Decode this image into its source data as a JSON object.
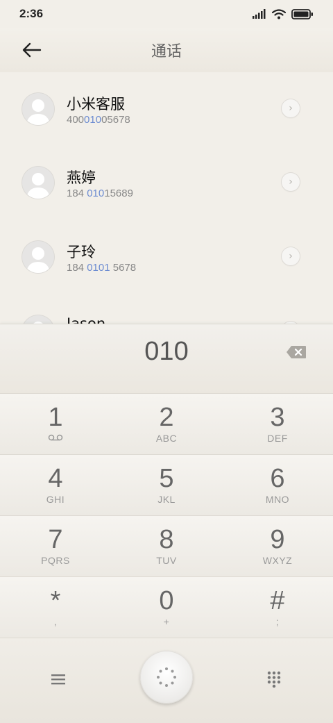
{
  "status": {
    "time": "2:36"
  },
  "header": {
    "title": "通话"
  },
  "contacts": [
    {
      "name": "小米客服",
      "number_pre": "400",
      "number_hl": "010",
      "number_post": "05678"
    },
    {
      "name": "燕婷",
      "number_pre": "184 ",
      "number_hl": "010",
      "number_post": "15689"
    },
    {
      "name": "子玲",
      "number_pre": "184 ",
      "number_hl": "0101",
      "number_post": " 5678"
    },
    {
      "name": "Jason",
      "number_pre": "",
      "number_hl": "",
      "number_post": ""
    }
  ],
  "input": {
    "value": "010"
  },
  "keypad": [
    {
      "digit": "1",
      "letters": ""
    },
    {
      "digit": "2",
      "letters": "ABC"
    },
    {
      "digit": "3",
      "letters": "DEF"
    },
    {
      "digit": "4",
      "letters": "GHI"
    },
    {
      "digit": "5",
      "letters": "JKL"
    },
    {
      "digit": "6",
      "letters": "MNO"
    },
    {
      "digit": "7",
      "letters": "PQRS"
    },
    {
      "digit": "8",
      "letters": "TUV"
    },
    {
      "digit": "9",
      "letters": "WXYZ"
    },
    {
      "digit": "*",
      "letters": ","
    },
    {
      "digit": "0",
      "letters": "+"
    },
    {
      "digit": "#",
      "letters": ";"
    }
  ],
  "icons": {
    "back": "arrow-left-icon",
    "detail": "chevron-right-icon",
    "backspace": "backspace-icon",
    "voicemail": "voicemail-icon",
    "menu": "menu-icon",
    "dial": "dial-icon",
    "keypad": "keypad-icon"
  },
  "colors": {
    "background": "#f2efe9",
    "highlight": "#6b8bd1",
    "text_primary": "#111111",
    "text_secondary": "#888888"
  }
}
